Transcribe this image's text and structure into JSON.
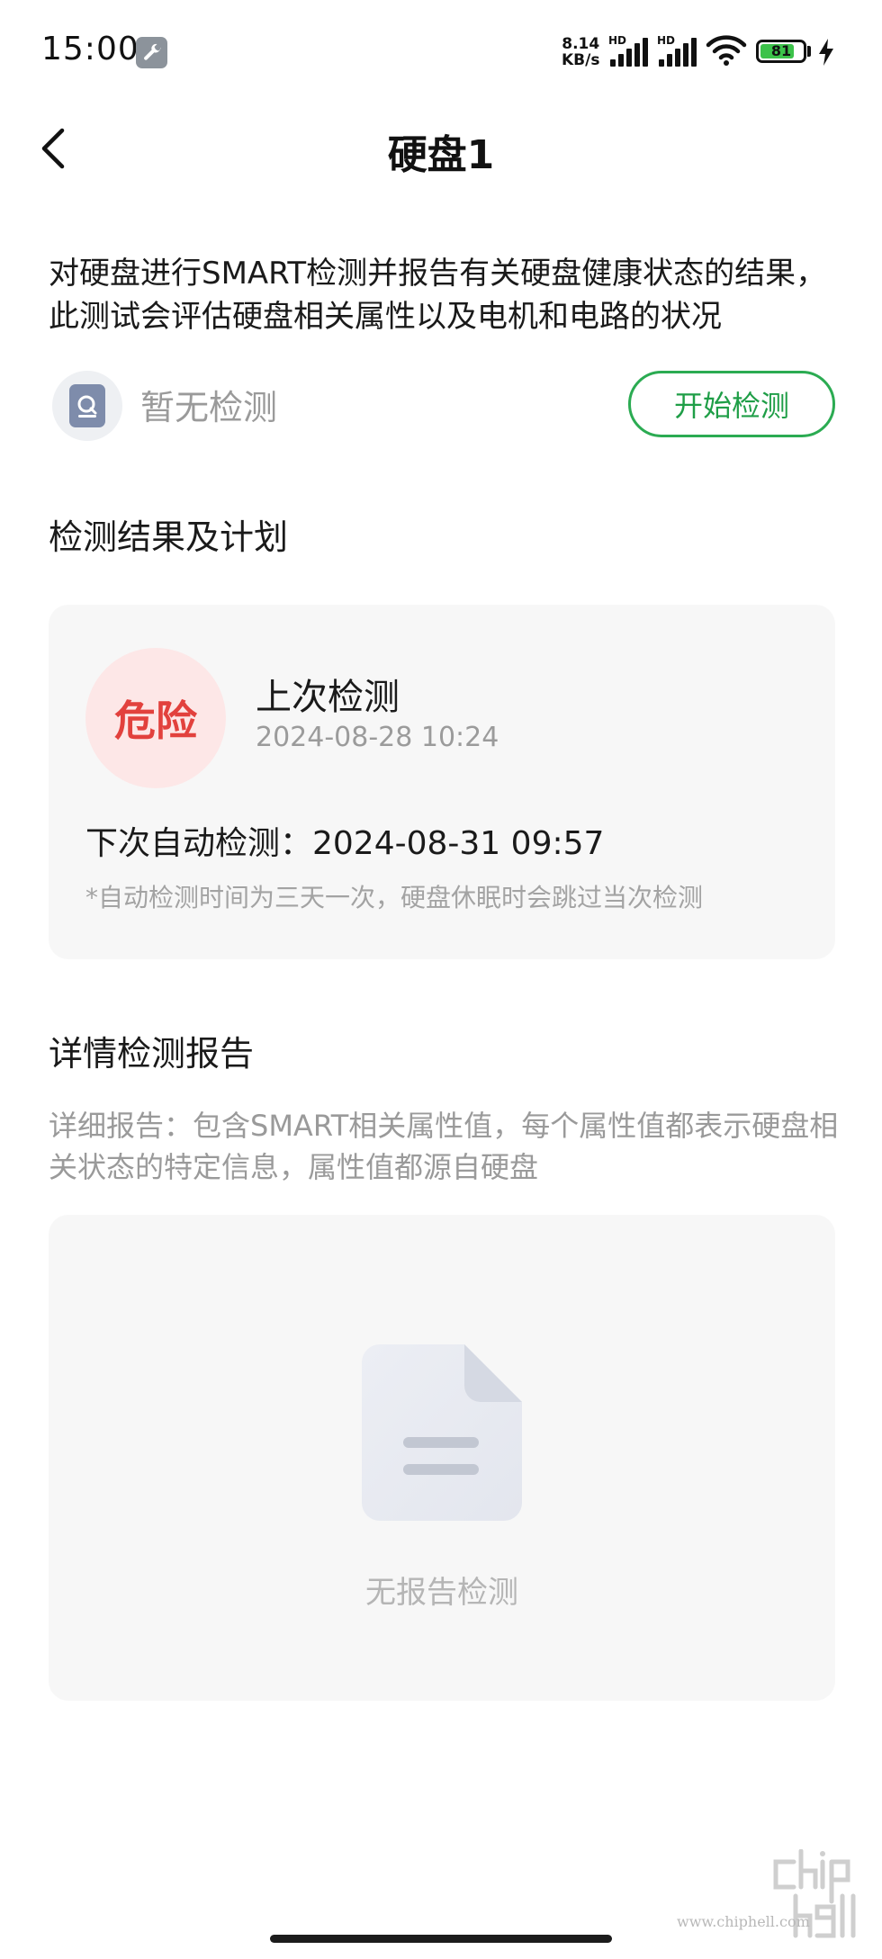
{
  "status_bar": {
    "time": "15:00",
    "net_speed_value": "8.14",
    "net_speed_unit": "KB/s",
    "hd_1": "HD",
    "hd_2": "HD",
    "battery": "81",
    "battery_level": 0.81,
    "icons": [
      "wrench-icon",
      "signal-icon",
      "wifi-icon",
      "battery-icon",
      "charging-bolt-icon"
    ]
  },
  "header": {
    "title": "硬盘1",
    "back_icon": "chevron-left-icon"
  },
  "intro": "对硬盘进行SMART检测并报告有关硬盘健康状态的结果，此测试会评估硬盘相关属性以及电机和电路的状况",
  "detect_status": {
    "icon": "disk-icon",
    "text": "暂无检测",
    "button": "开始检测"
  },
  "results": {
    "section_title": "检测结果及计划",
    "status": "危险",
    "last_label": "上次检测",
    "last_time": "2024-08-28 10:24",
    "next_label": "下次自动检测：2024-08-31 09:57",
    "note": "*自动检测时间为三天一次，硬盘休眠时会跳过当次检测"
  },
  "report": {
    "section_title": "详情检测报告",
    "description": "详细报告：包含SMART相关属性值，每个属性值都表示硬盘相关状态的特定信息，属性值都源自硬盘",
    "empty_icon": "document-icon",
    "empty_text": "无报告检测"
  },
  "watermark": {
    "url": "www.chiphell.com"
  },
  "colors": {
    "accent_green": "#2bab52",
    "danger_red": "#e2413d",
    "danger_bg": "#fde7e7",
    "card_bg": "#f7f7f7"
  }
}
